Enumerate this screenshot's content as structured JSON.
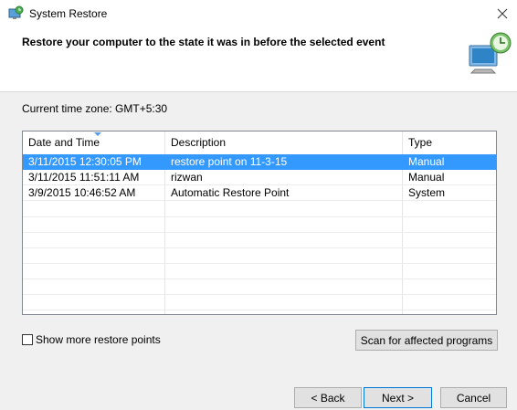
{
  "window": {
    "title": "System Restore",
    "icons": {
      "app": "system-restore-icon",
      "close": "close-icon",
      "header": "restore-monitor-clock-icon"
    }
  },
  "header": {
    "headline": "Restore your computer to the state it was in before the selected event"
  },
  "timezone": "Current time zone: GMT+5:30",
  "table": {
    "columns": [
      "Date and Time",
      "Description",
      "Type"
    ],
    "rows": [
      {
        "date": "3/11/2015 12:30:05 PM",
        "description": "restore point on 11-3-15",
        "type": "Manual",
        "selected": true
      },
      {
        "date": "3/11/2015 11:51:11 AM",
        "description": "rizwan",
        "type": "Manual",
        "selected": false
      },
      {
        "date": "3/9/2015 10:46:52 AM",
        "description": "Automatic Restore Point",
        "type": "System",
        "selected": false
      }
    ]
  },
  "options": {
    "show_more_label": "Show more restore points",
    "show_more_checked": false
  },
  "buttons": {
    "scan": "Scan for affected programs",
    "back": "< Back",
    "next": "Next >",
    "cancel": "Cancel"
  },
  "colors": {
    "selection": "#3399ff",
    "default_button_border": "#0078d7"
  }
}
